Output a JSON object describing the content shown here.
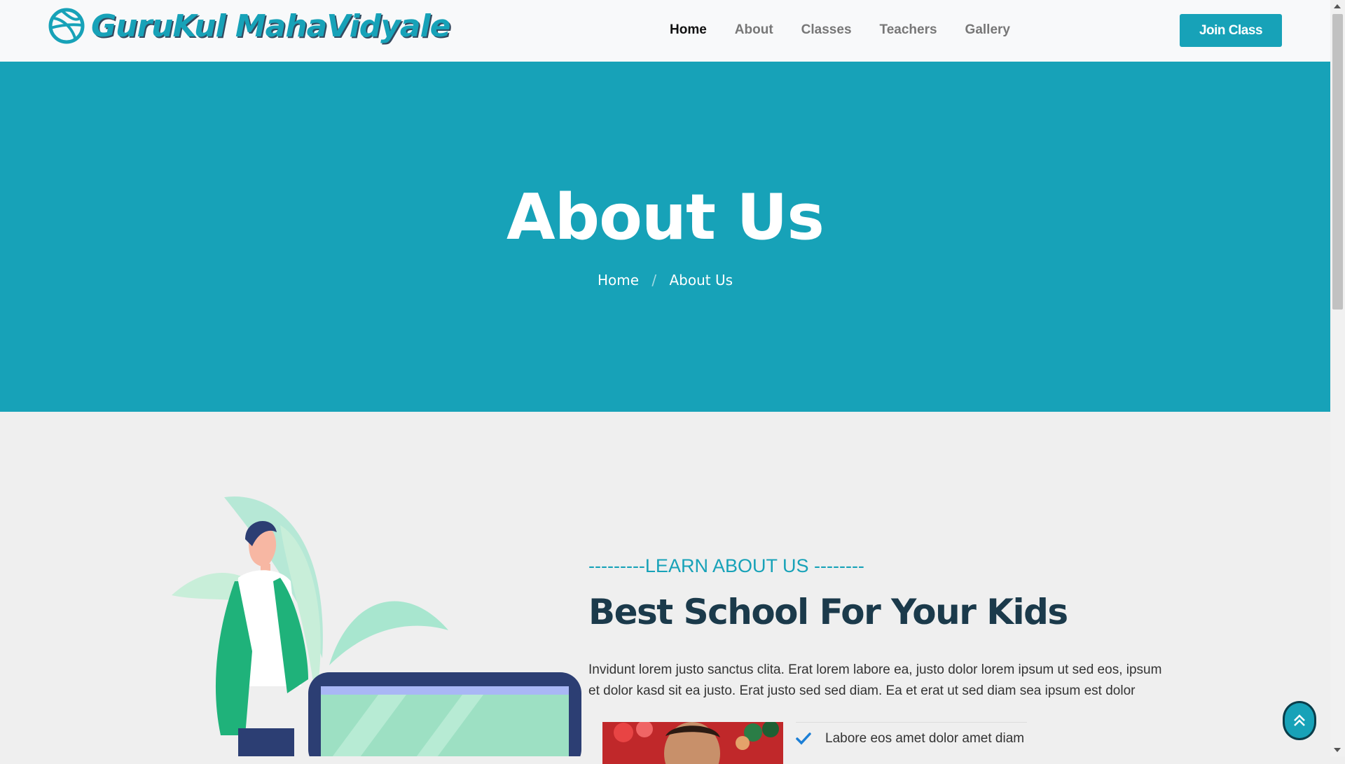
{
  "brand": {
    "name": "GuruKul MahaVidyale",
    "icon": "dribbble-icon",
    "color": "#17a2b8"
  },
  "nav": {
    "items": [
      {
        "label": "Home",
        "active": true
      },
      {
        "label": "About",
        "active": false
      },
      {
        "label": "Classes",
        "active": false
      },
      {
        "label": "Teachers",
        "active": false
      },
      {
        "label": "Gallery",
        "active": false
      }
    ],
    "cta_label": "Join Class"
  },
  "hero": {
    "title": "About Us",
    "breadcrumb": [
      "Home",
      "About Us"
    ],
    "background": "#17a2b8"
  },
  "about": {
    "eyebrow": "---------LEARN ABOUT US --------",
    "title": "Best School For Your Kids",
    "text": "Invidunt lorem justo sanctus clita. Erat lorem labore ea, justo dolor lorem ipsum ut sed eos, ipsum et dolor kasd sit ea justo. Erat justo sed sed diam. Ea et erat ut sed diam sea ipsum est dolor",
    "features": [
      "Labore eos amet dolor amet diam"
    ]
  },
  "icons": {
    "check": "check-icon",
    "back_to_top": "double-chevron-up-icon"
  }
}
